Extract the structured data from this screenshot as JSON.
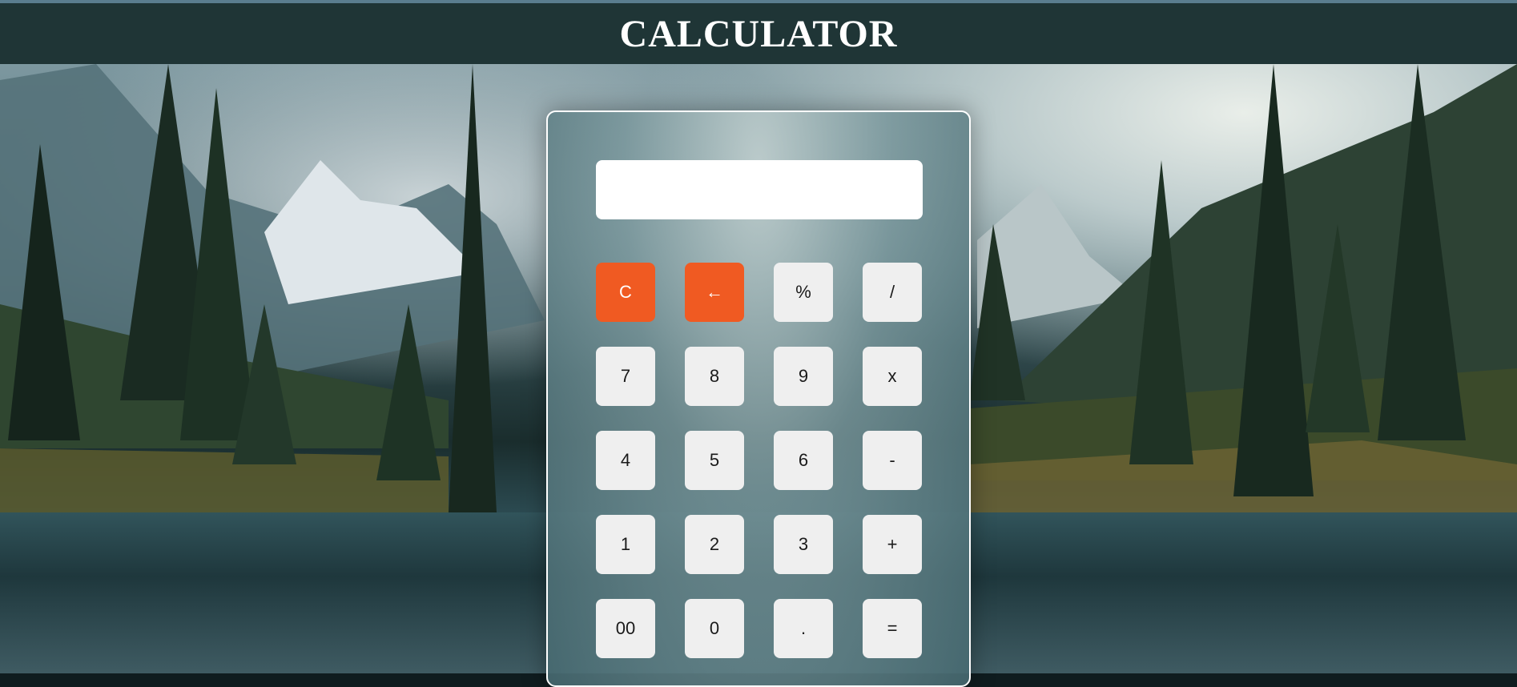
{
  "header": {
    "title": "CALCULATOR"
  },
  "display": {
    "value": ""
  },
  "keys": [
    [
      "C",
      "←",
      "%",
      "/"
    ],
    [
      "7",
      "8",
      "9",
      "x"
    ],
    [
      "4",
      "5",
      "6",
      "-"
    ],
    [
      "1",
      "2",
      "3",
      "+"
    ],
    [
      "00",
      "0",
      ".",
      "="
    ]
  ],
  "colors": {
    "header_bg": "#1f3536",
    "accent_orange": "#f05a22",
    "key_bg": "#efefef"
  }
}
